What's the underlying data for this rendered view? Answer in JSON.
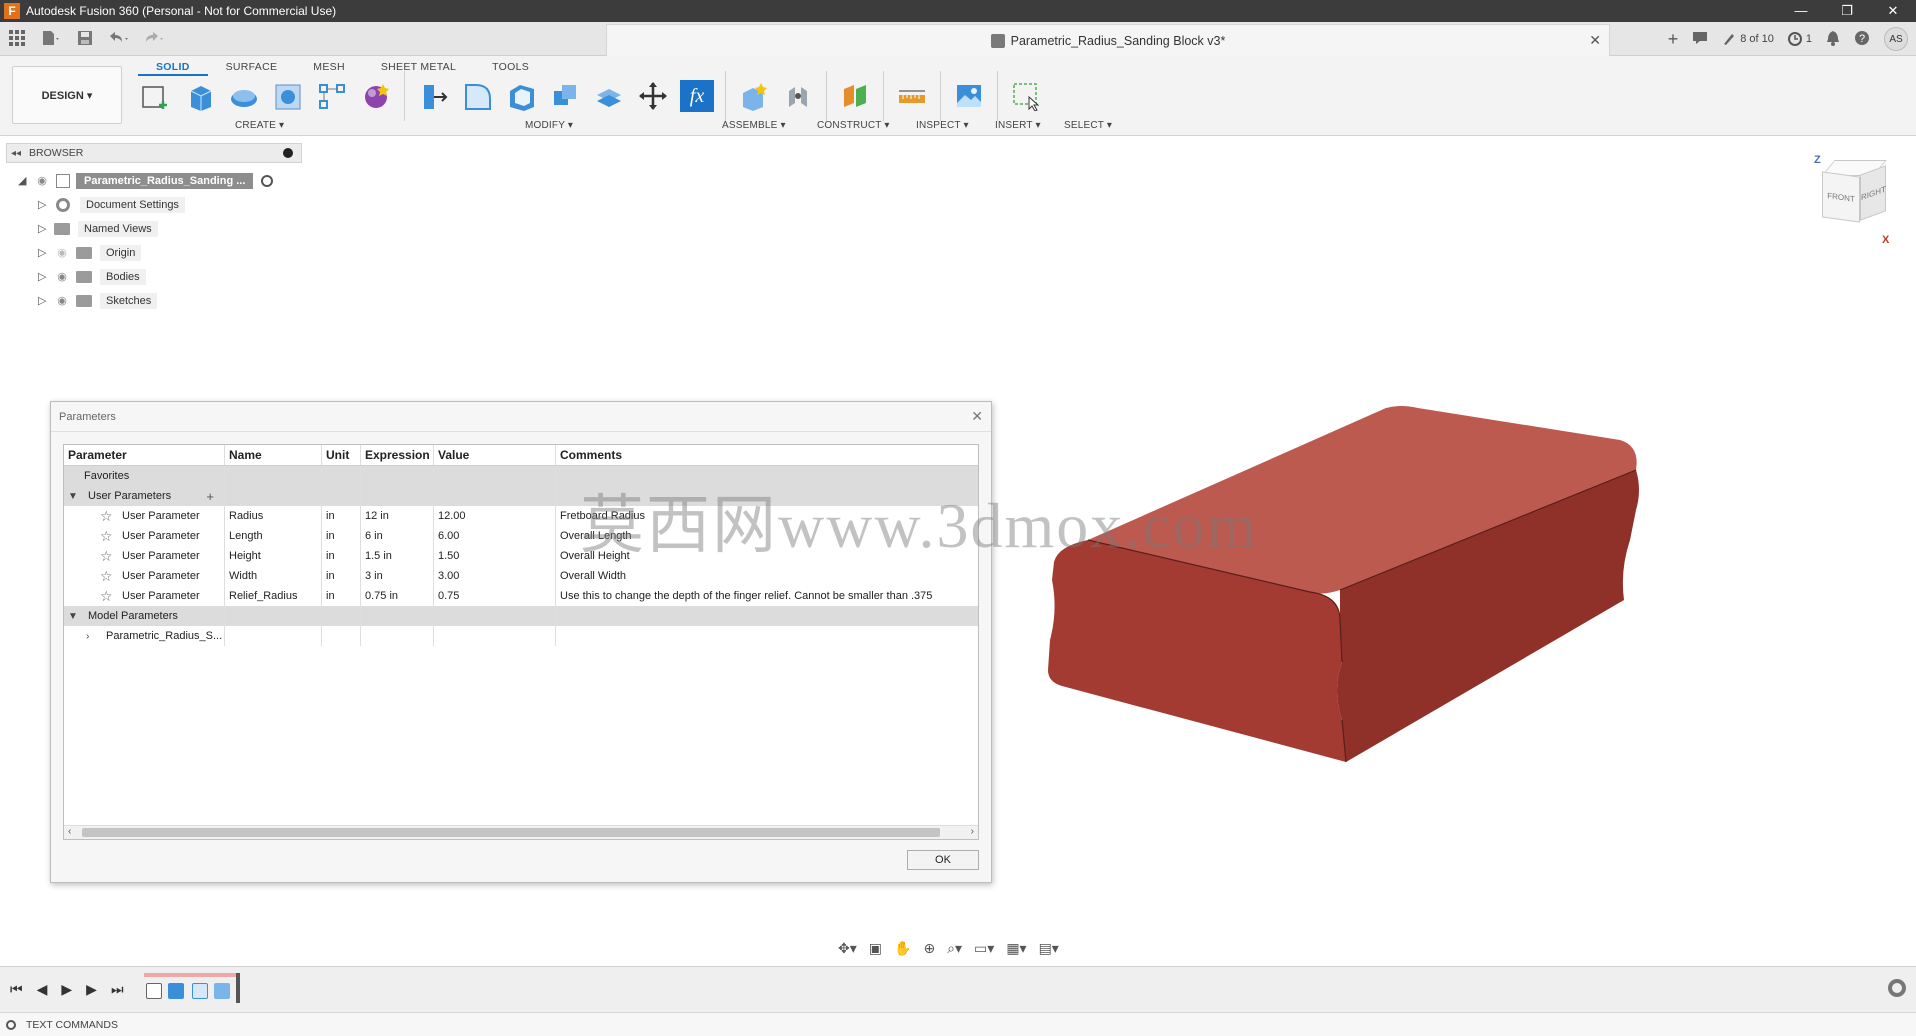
{
  "window": {
    "title": "Autodesk Fusion 360 (Personal - Not for Commercial Use)",
    "logo_letter": "F",
    "min": "—",
    "restore": "❐",
    "close": "✕"
  },
  "document": {
    "tab_title": "Parametric_Radius_Sanding Block v3*",
    "close": "✕",
    "job_status": "8 of 10",
    "clock_count": "1",
    "user_initials": "AS"
  },
  "toolbar": {
    "workspace": "DESIGN ▾",
    "tabs": [
      "SOLID",
      "SURFACE",
      "MESH",
      "SHEET METAL",
      "TOOLS"
    ],
    "groups": {
      "create": "CREATE ▾",
      "modify": "MODIFY ▾",
      "assemble": "ASSEMBLE ▾",
      "construct": "CONSTRUCT ▾",
      "inspect": "INSPECT ▾",
      "insert": "INSERT ▾",
      "select": "SELECT ▾"
    },
    "fx_label": "fx",
    "accent": "#1a73c9"
  },
  "browser": {
    "title": "BROWSER",
    "root": "Parametric_Radius_Sanding ...",
    "items": [
      "Document Settings",
      "Named Views",
      "Origin",
      "Bodies",
      "Sketches"
    ]
  },
  "viewcube": {
    "front": "FRONT",
    "right": "RIGHT",
    "z": "Z",
    "x": "X"
  },
  "parameters": {
    "title": "Parameters",
    "close": "✕",
    "columns": [
      "Parameter",
      "Name",
      "Unit",
      "Expression",
      "Value",
      "Comments"
    ],
    "favorites": "Favorites",
    "user_group": "User Parameters",
    "user_rows": [
      {
        "param": "User Parameter",
        "name": "Radius",
        "unit": "in",
        "expr": "12 in",
        "value": "12.00",
        "comment": "Fretboard Radius"
      },
      {
        "param": "User Parameter",
        "name": "Length",
        "unit": "in",
        "expr": "6 in",
        "value": "6.00",
        "comment": "Overall Length"
      },
      {
        "param": "User Parameter",
        "name": "Height",
        "unit": "in",
        "expr": "1.5 in",
        "value": "1.50",
        "comment": "Overall Height"
      },
      {
        "param": "User Parameter",
        "name": "Width",
        "unit": "in",
        "expr": "3 in",
        "value": "3.00",
        "comment": "Overall Width"
      },
      {
        "param": "User Parameter",
        "name": "Relief_Radius",
        "unit": "in",
        "expr": "0.75 in",
        "value": "0.75",
        "comment": "Use this to change the depth of the finger relief. Cannot be smaller than .375"
      }
    ],
    "model_group": "Model Parameters",
    "model_rows": [
      "Parametric_Radius_S..."
    ],
    "ok": "OK"
  },
  "watermark": "莫西网www.3dmox.com",
  "model_color": "#a8403a",
  "textcommands": "TEXT COMMANDS"
}
